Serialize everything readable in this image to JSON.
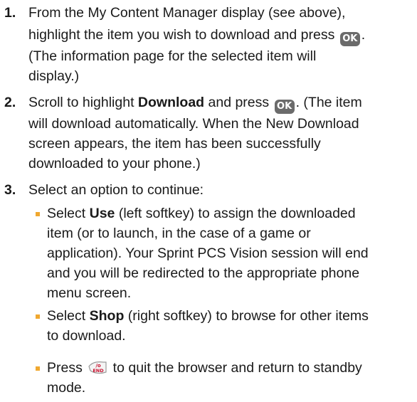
{
  "steps": [
    {
      "number": "1.",
      "line1": "From the My Content Manager display (see above),",
      "line2a": "highlight the item you wish to download and press",
      "ok_key": "OK",
      "line2b": ".",
      "line3": "(The information page for the selected item will",
      "line4": "display.)"
    },
    {
      "number": "2.",
      "line1a": "Scroll to highlight ",
      "line1b": "Download",
      "line1c": " and press ",
      "ok_key": "OK",
      "line1d": ". (The item",
      "line2": "will download automatically. When the New Download",
      "line3": "screen appears, the item has been successfully",
      "line4": "downloaded to your phone.)"
    },
    {
      "number": "3.",
      "line1": "Select an option to continue:"
    }
  ],
  "bullets": [
    {
      "a": "Select ",
      "b": "Use",
      "c": " (left softkey) to assign the downloaded",
      "l2": "item (or to launch, in the case of a game or",
      "l3": "application). Your Sprint PCS Vision session will end",
      "l4": "and you will be redirected to the appropriate phone",
      "l5": "menu screen."
    },
    {
      "a": "Select ",
      "b": "Shop",
      "c": " (right softkey) to browse for other items",
      "l2": "to download."
    },
    {
      "a": "Press ",
      "end_key_icon": "end-key-icon",
      "c": " to quit the browser and return to standby",
      "l2": "mode."
    }
  ],
  "colors": {
    "bullet": "#f0a830",
    "key": "#6b6b6b",
    "end_key": "#c8102e"
  }
}
